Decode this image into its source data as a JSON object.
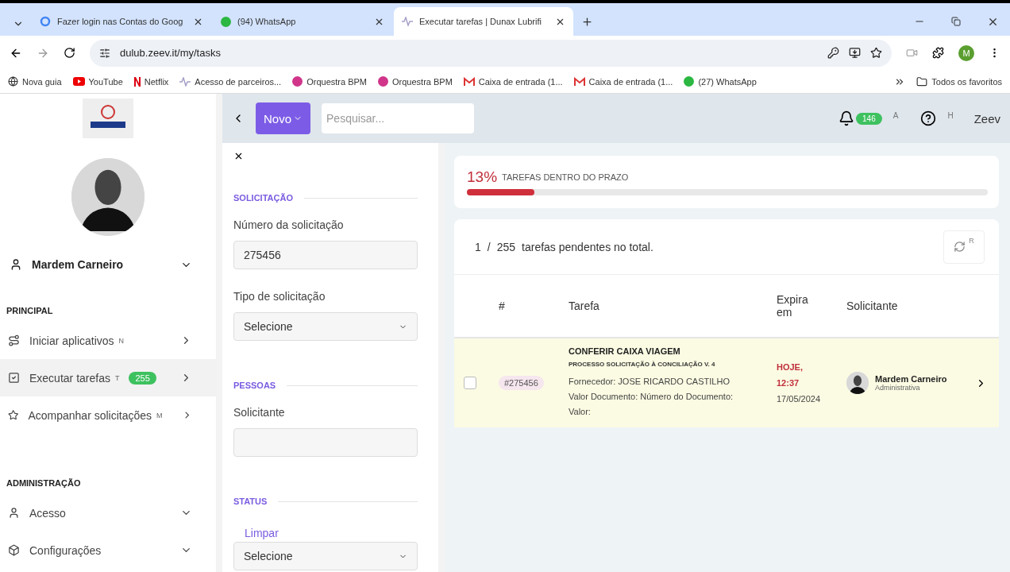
{
  "browser": {
    "tabs": [
      {
        "title": "Fazer login nas Contas do Goog",
        "selected": false
      },
      {
        "title": "(94) WhatsApp",
        "selected": false
      },
      {
        "title": "Executar tarefas | Dunax Lubrifi",
        "selected": true
      }
    ],
    "url": "dulub.zeev.it/my/tasks",
    "profile": "M",
    "bookmarks": [
      "Nova guia",
      "YouTube",
      "Netflix",
      "Acesso de parceiros...",
      "Orquestra BPM",
      "Orquestra BPM",
      "Caixa de entrada (1...",
      "Caixa de entrada (1...",
      "(27) WhatsApp"
    ],
    "all_bookmarks": "Todos os favoritos"
  },
  "sidebar": {
    "user": "Mardem Carneiro",
    "sections": [
      {
        "title": "PRINCIPAL",
        "items": [
          {
            "label": "Iniciar aplicativos",
            "shortcut": "N",
            "selected": false,
            "kind": "link"
          },
          {
            "label": "Executar tarefas",
            "shortcut": "T",
            "badge": "255",
            "selected": true,
            "kind": "link"
          },
          {
            "label": "Acompanhar solicitações",
            "shortcut": "M",
            "selected": false,
            "kind": "link"
          }
        ]
      },
      {
        "title": "ADMINISTRAÇÃO",
        "items": [
          {
            "label": "Acesso",
            "selected": false,
            "kind": "group"
          },
          {
            "label": "Configurações",
            "selected": false,
            "kind": "group"
          }
        ]
      }
    ]
  },
  "topbar": {
    "new_button": "Novo",
    "search": {
      "placeholder": "Pesquisar..."
    },
    "notifications": "146",
    "notifications_shortcut": "A",
    "help_shortcut": "H",
    "brand": "Zeev"
  },
  "filters": {
    "sections": [
      {
        "title": "SOLICITAÇÃO",
        "fields": [
          {
            "label": "Número da solicitação",
            "kind": "text",
            "value": "275456"
          },
          {
            "label": "Tipo de solicitação",
            "kind": "select",
            "value": "Selecione"
          }
        ]
      },
      {
        "title": "PESSOAS",
        "fields": [
          {
            "label": "Solicitante",
            "kind": "text"
          }
        ]
      },
      {
        "title": "STATUS"
      }
    ],
    "clear_link": "Limpar",
    "bottom_select": "Selecione"
  },
  "progress": {
    "percent": "13%",
    "label": "TAREFAS DENTRO DO PRAZO",
    "level": 0.13
  },
  "tasks": {
    "count": "1",
    "separator": "/",
    "total": "255",
    "summary": "tarefas pendentes no total.",
    "refresh_shortcut": "R",
    "columns": [
      "#",
      "Tarefa",
      "Expira em",
      "Solicitante"
    ],
    "rows": [
      {
        "checked": false,
        "number": "#275456",
        "title": "CONFERIR CAIXA VIAGEM",
        "process": "PROCESSO SOLICITAÇÃO À CONCILIAÇÃO V. 4",
        "details": [
          "Fornecedor: JOSE RICARDO CASTILHO",
          "Valor Documento: Número do Documento:",
          "Valor:"
        ],
        "expires_day": "HOJE,",
        "expires_time": "12:37",
        "expires_date": "17/05/2024",
        "requester": "Mardem Carneiro",
        "department": "Administrativa"
      }
    ]
  }
}
